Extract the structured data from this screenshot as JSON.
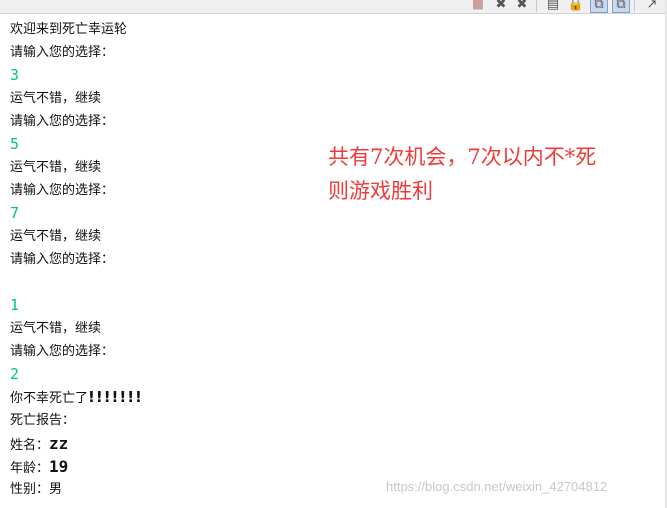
{
  "toolbar": {
    "icons": [
      "terminate-icon",
      "remove-launch-icon",
      "remove-all-icon",
      "clear-console-icon",
      "scroll-lock-icon",
      "pin-console-icon",
      "display-selected-console-icon",
      "open-console-icon"
    ]
  },
  "console": {
    "lines": [
      {
        "type": "text",
        "text": "欢迎来到死亡幸运轮"
      },
      {
        "type": "text",
        "text": "请输入您的选择："
      },
      {
        "type": "input",
        "text": "3"
      },
      {
        "type": "text",
        "text": "运气不错，继续"
      },
      {
        "type": "text",
        "text": "请输入您的选择："
      },
      {
        "type": "input",
        "text": "5"
      },
      {
        "type": "text",
        "text": "运气不错，继续"
      },
      {
        "type": "text",
        "text": "请输入您的选择："
      },
      {
        "type": "input",
        "text": "7"
      },
      {
        "type": "text",
        "text": "运气不错，继续"
      },
      {
        "type": "text",
        "text": "请输入您的选择："
      },
      {
        "type": "text",
        "text": ""
      },
      {
        "type": "input",
        "text": "1"
      },
      {
        "type": "text",
        "text": "运气不错，继续"
      },
      {
        "type": "text",
        "text": "请输入您的选择："
      },
      {
        "type": "input",
        "text": "2"
      },
      {
        "type": "bang",
        "text": "你不幸死亡了",
        "suffix": "!!!!!!!"
      },
      {
        "type": "text",
        "text": "死亡报告："
      },
      {
        "type": "kv",
        "text": "姓名：",
        "value": "zz"
      },
      {
        "type": "kv",
        "text": "年龄：",
        "value": "19"
      },
      {
        "type": "text",
        "text": "性别：男"
      }
    ]
  },
  "annotation": "共有7次机会，7次以内不*死\n则游戏胜利",
  "watermark": "https://blog.csdn.net/weixin_42704812",
  "colors": {
    "input_text": "#00c87a",
    "annotation": "#f03a3a",
    "watermark": "#c8c8c8"
  }
}
